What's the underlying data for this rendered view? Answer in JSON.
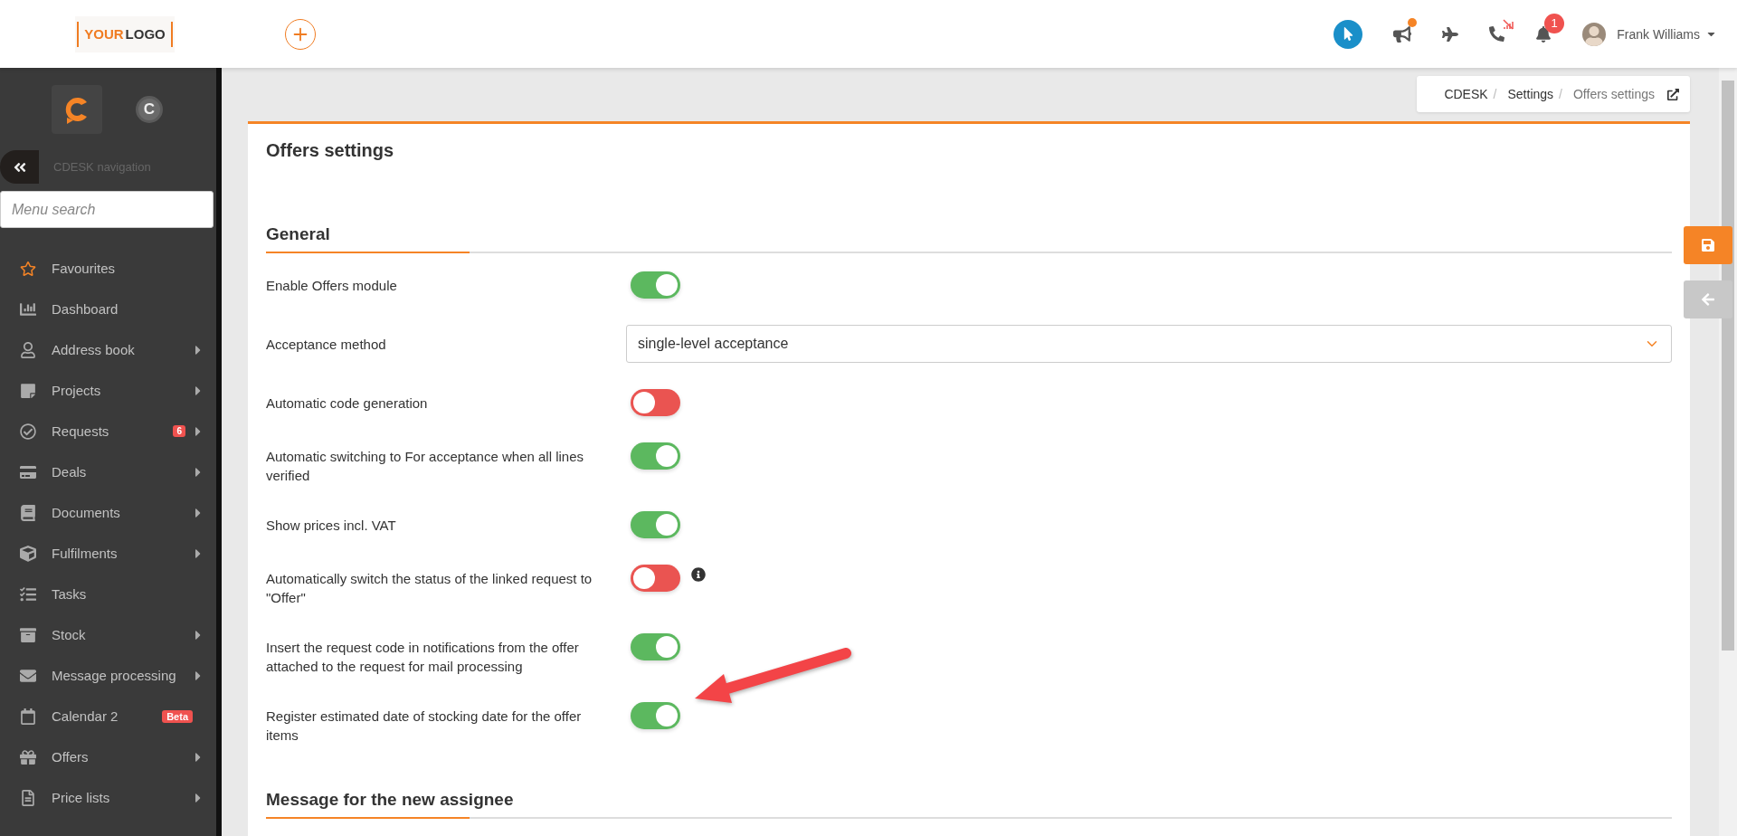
{
  "header": {
    "logo": [
      "YOUR",
      "LOGO"
    ],
    "user_name": "Frank Williams",
    "notification_count": "1",
    "announcement_unread": true
  },
  "sidebar": {
    "company_initial": "C",
    "navigation_title": "CDESK navigation",
    "search": {
      "placeholder": "Menu search"
    },
    "items": [
      {
        "label": "Favourites",
        "has_submenu": false
      },
      {
        "label": "Dashboard",
        "has_submenu": false
      },
      {
        "label": "Address book",
        "has_submenu": true
      },
      {
        "label": "Projects",
        "has_submenu": true
      },
      {
        "label": "Requests",
        "has_submenu": true,
        "badge": "6"
      },
      {
        "label": "Deals",
        "has_submenu": true
      },
      {
        "label": "Documents",
        "has_submenu": true
      },
      {
        "label": "Fulfilments",
        "has_submenu": true
      },
      {
        "label": "Tasks",
        "has_submenu": false
      },
      {
        "label": "Stock",
        "has_submenu": true
      },
      {
        "label": "Message processing",
        "has_submenu": true
      },
      {
        "label": "Calendar 2",
        "has_submenu": false,
        "badge": "Beta"
      },
      {
        "label": "Offers",
        "has_submenu": true
      },
      {
        "label": "Price lists",
        "has_submenu": true
      }
    ]
  },
  "breadcrumbs": [
    {
      "label": "CDESK",
      "separator": "/"
    },
    {
      "label": "Settings",
      "separator": "/"
    },
    {
      "label": "Offers settings"
    }
  ],
  "page_title": "Offers settings",
  "sections": [
    {
      "title": "General",
      "rows": [
        {
          "kind": "toggle",
          "label": "Enable Offers module",
          "on": true
        },
        {
          "kind": "select",
          "label": "Acceptance method",
          "value": "single-level acceptance"
        },
        {
          "kind": "toggle",
          "label": "Automatic code generation",
          "on": false
        },
        {
          "kind": "toggle",
          "label": "Automatic switching to For acceptance when all lines verified",
          "on": true
        },
        {
          "kind": "toggle",
          "label": "Show prices incl. VAT",
          "on": true
        },
        {
          "kind": "toggle",
          "label": "Automatically switch the status of the linked request to \"Offer\"",
          "on": false,
          "info": true
        },
        {
          "kind": "toggle",
          "label": "Insert the request code in notifications from the offer attached to the request for mail processing",
          "on": true
        },
        {
          "kind": "toggle",
          "label": "Register estimated date of stocking date for the offer items",
          "on": true
        }
      ]
    },
    {
      "title": "Message for the new assignee"
    }
  ]
}
